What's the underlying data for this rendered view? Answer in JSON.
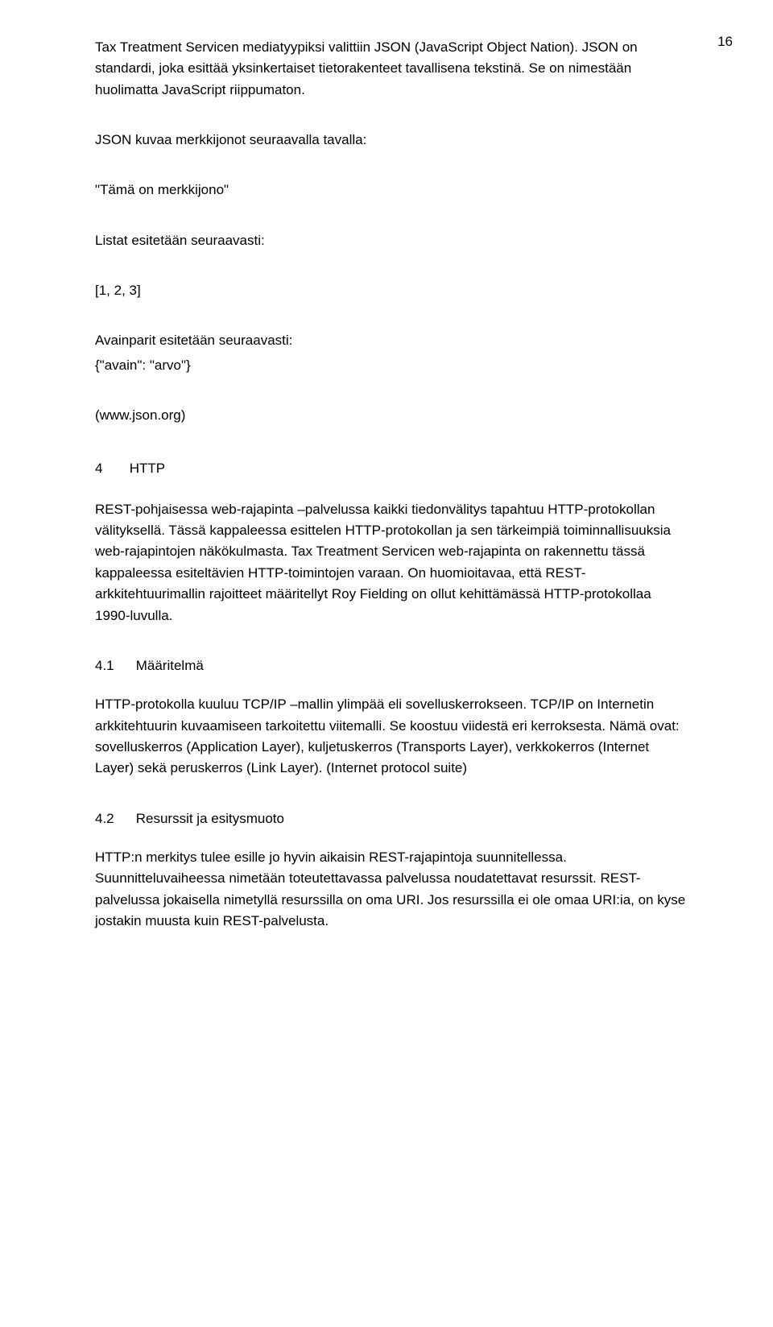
{
  "page_number": "16",
  "paragraphs": {
    "p1": "Tax Treatment Servicen mediatyypiksi valittiin JSON (JavaScript Object Nation). JSON on standardi, joka esittää yksinkertaiset tietorakenteet tavallisena tekstinä. Se on nimestään huolimatta JavaScript riippumaton.",
    "p2": "JSON kuvaa merkkijonot seuraavalla tavalla:",
    "p3": "\"Tämä on merkkijono\"",
    "p4": "Listat esitetään seuraavasti:",
    "p5": "[1, 2, 3]",
    "p6": "Avainparit esitetään seuraavasti:",
    "p7": "{\"avain\": \"arvo\"}",
    "p8": "(www.json.org)",
    "p9": "REST-pohjaisessa web-rajapinta –palvelussa kaikki tiedonvälitys tapahtuu HTTP-protokollan välityksellä. Tässä kappaleessa esittelen HTTP-protokollan ja sen tärkeimpiä toiminnallisuuksia web-rajapintojen näkökulmasta. Tax Treatment Servicen web-rajapinta on rakennettu tässä kappaleessa esiteltävien HTTP-toimintojen varaan. On huomioitavaa, että REST-arkkitehtuurimallin rajoitteet määritellyt Roy Fielding on ollut kehittämässä HTTP-protokollaa 1990-luvulla.",
    "p10": "HTTP-protokolla kuuluu TCP/IP –mallin ylimpää eli sovelluskerrokseen. TCP/IP on Internetin arkkitehtuurin kuvaamiseen tarkoitettu viitemalli. Se koostuu viidestä eri kerroksesta. Nämä ovat: sovelluskerros (Application Layer), kuljetuskerros (Transports Layer), verkkokerros (Internet Layer) sekä peruskerros (Link Layer). (Internet protocol suite)",
    "p11": "HTTP:n merkitys tulee esille jo hyvin aikaisin REST-rajapintoja suunnitellessa. Suunnitteluvaiheessa nimetään toteutettavassa palvelussa noudatettavat resurssit. REST-palvelussa jokaisella nimetyllä resurssilla on oma URI. Jos resurssilla ei ole omaa URI:ia, on kyse jostakin muusta kuin REST-palvelusta."
  },
  "headings": {
    "h4_num": "4",
    "h4_title": "HTTP",
    "h41_num": "4.1",
    "h41_title": "Määritelmä",
    "h42_num": "4.2",
    "h42_title": "Resurssit ja esitysmuoto"
  }
}
